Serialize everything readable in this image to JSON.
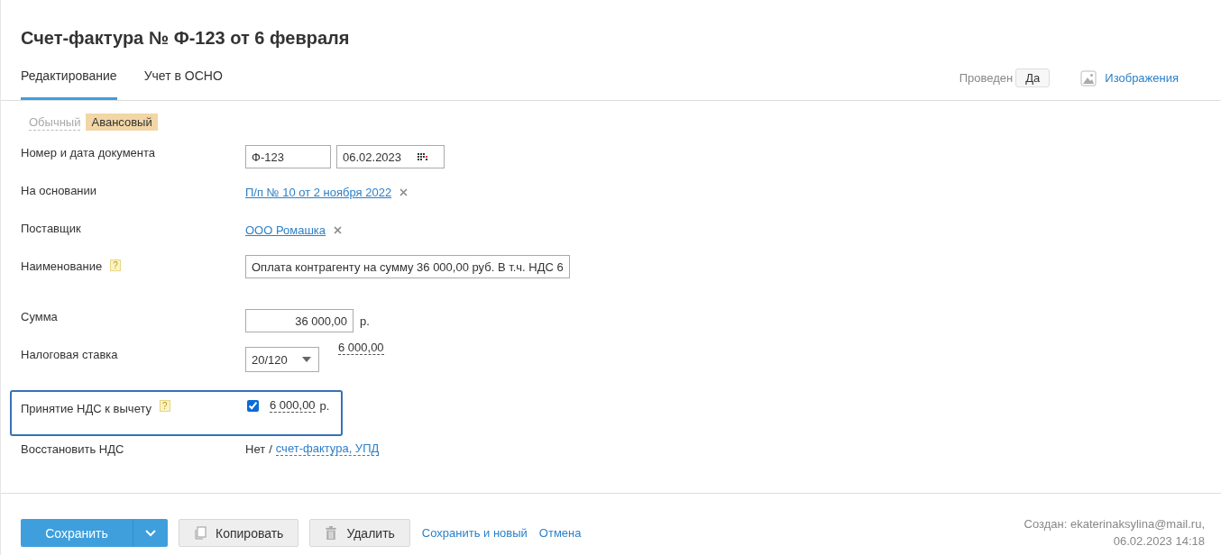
{
  "title": "Счет-фактура № Ф-123 от 6 февраля",
  "tabs": [
    {
      "label": "Редактирование",
      "selected": true
    },
    {
      "label": "Учет в ОСНО",
      "selected": false
    }
  ],
  "posted": {
    "label": "Проведен",
    "value": "Да"
  },
  "images_link": "Изображения",
  "types": [
    {
      "label": "Обычный",
      "selected": false
    },
    {
      "label": "Авансовый",
      "selected": true
    }
  ],
  "rows": [
    {
      "kind": "number-date",
      "label": "Номер и дата документа",
      "number": "Ф-123",
      "date": "06.02.2023"
    },
    {
      "kind": "link",
      "label": "На основании",
      "link": "П/п № 10 от 2 ноября 2022"
    },
    {
      "kind": "link",
      "label": "Поставщик",
      "link": "ООО Ромашка"
    },
    {
      "kind": "text",
      "label": "Наименование",
      "help": "?",
      "value": "Оплата контрагенту на сумму 36 000,00 руб. В т.ч. НДС 6"
    },
    {
      "kind": "amount",
      "label": "Сумма",
      "value": "36 000,00",
      "unit": "р."
    },
    {
      "kind": "rate",
      "label": "Налоговая ставка",
      "value": "20/120",
      "tax": "6 000,00"
    },
    {
      "kind": "deduction",
      "label": "Принятие НДС к вычету",
      "help": "?",
      "checked": true,
      "highlighted": true,
      "amount": "6 000,00",
      "unit": "р."
    },
    {
      "kind": "restore",
      "label": "Восстановить НДС",
      "value": "Нет",
      "separator": "/",
      "link": "счет-фактура, УПД"
    }
  ],
  "buttons": {
    "save": "Сохранить",
    "copy": "Копировать",
    "delete": "Удалить",
    "save_new": "Сохранить и новый",
    "cancel": "Отмена"
  },
  "created": {
    "line1": "Создан: ekaterinaksylina@mail.ru,",
    "line2": "06.02.2023 14:18"
  }
}
